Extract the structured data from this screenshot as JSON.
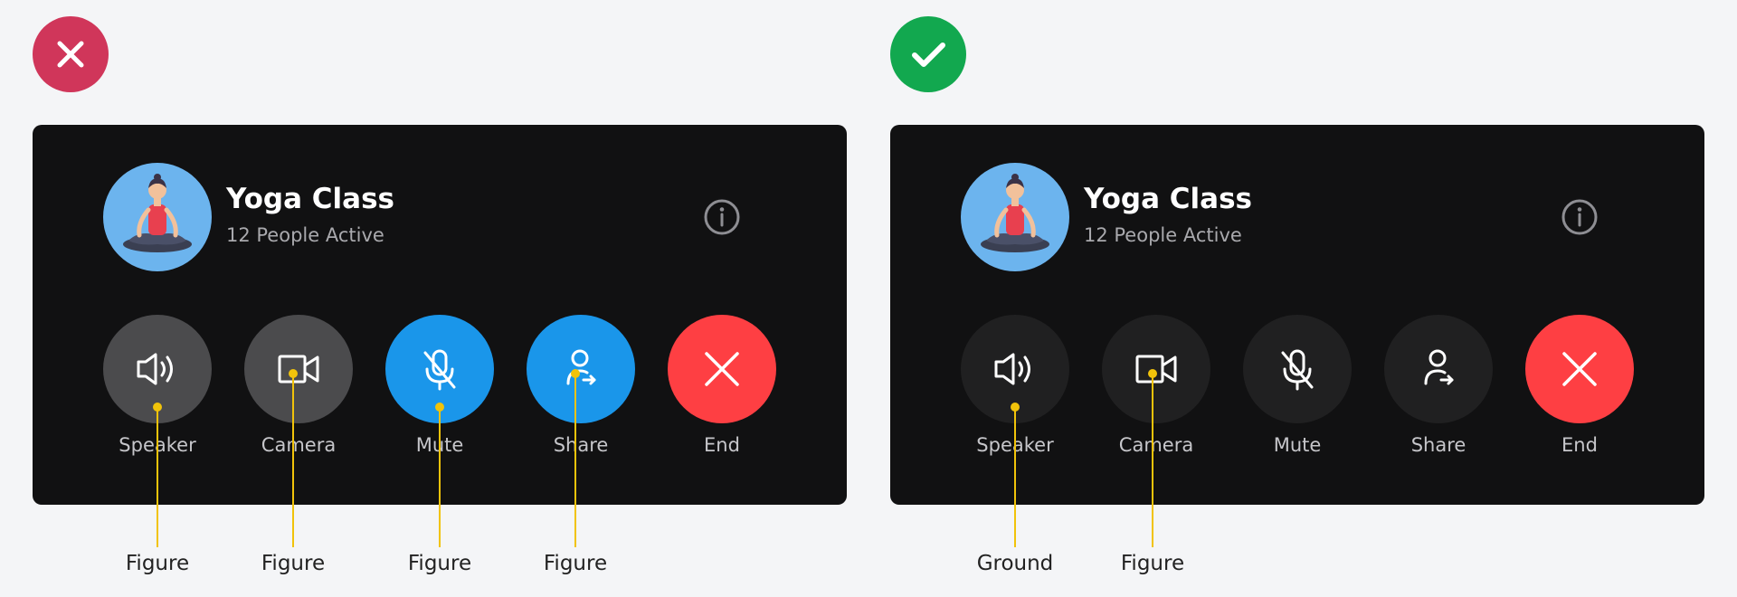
{
  "panels": [
    {
      "verdict": "incorrect",
      "verdict_icon": "x-icon",
      "verdict_color": "#d0365a",
      "call": {
        "title": "Yoga Class",
        "subtitle": "12 People Active",
        "avatar_icon": "yoga-meditation-icon",
        "info_icon": "info-icon"
      },
      "controls": [
        {
          "label": "Speaker",
          "icon": "speaker-icon",
          "bg": "#4b4b4d"
        },
        {
          "label": "Camera",
          "icon": "video-camera-icon",
          "bg": "#4b4b4d"
        },
        {
          "label": "Mute",
          "icon": "mic-off-icon",
          "bg": "#1a96ea"
        },
        {
          "label": "Share",
          "icon": "share-user-icon",
          "bg": "#1a96ea"
        },
        {
          "label": "End",
          "icon": "close-icon",
          "bg": "#fe3f43"
        }
      ],
      "annotations": [
        "Figure",
        "Figure",
        "Figure",
        "Figure"
      ]
    },
    {
      "verdict": "correct",
      "verdict_icon": "check-icon",
      "verdict_color": "#12a84f",
      "call": {
        "title": "Yoga Class",
        "subtitle": "12 People Active",
        "avatar_icon": "yoga-meditation-icon",
        "info_icon": "info-icon"
      },
      "controls": [
        {
          "label": "Speaker",
          "icon": "speaker-icon",
          "bg": "#202021"
        },
        {
          "label": "Camera",
          "icon": "video-camera-icon",
          "bg": "#202021"
        },
        {
          "label": "Mute",
          "icon": "mic-off-icon",
          "bg": "#202021"
        },
        {
          "label": "Share",
          "icon": "share-user-icon",
          "bg": "#202021"
        },
        {
          "label": "End",
          "icon": "close-icon",
          "bg": "#fe3f43"
        }
      ],
      "annotations": [
        "Ground",
        "Figure"
      ]
    }
  ],
  "colors": {
    "card": "#111112",
    "leader": "#f1c30a",
    "page": "#f4f5f7"
  }
}
